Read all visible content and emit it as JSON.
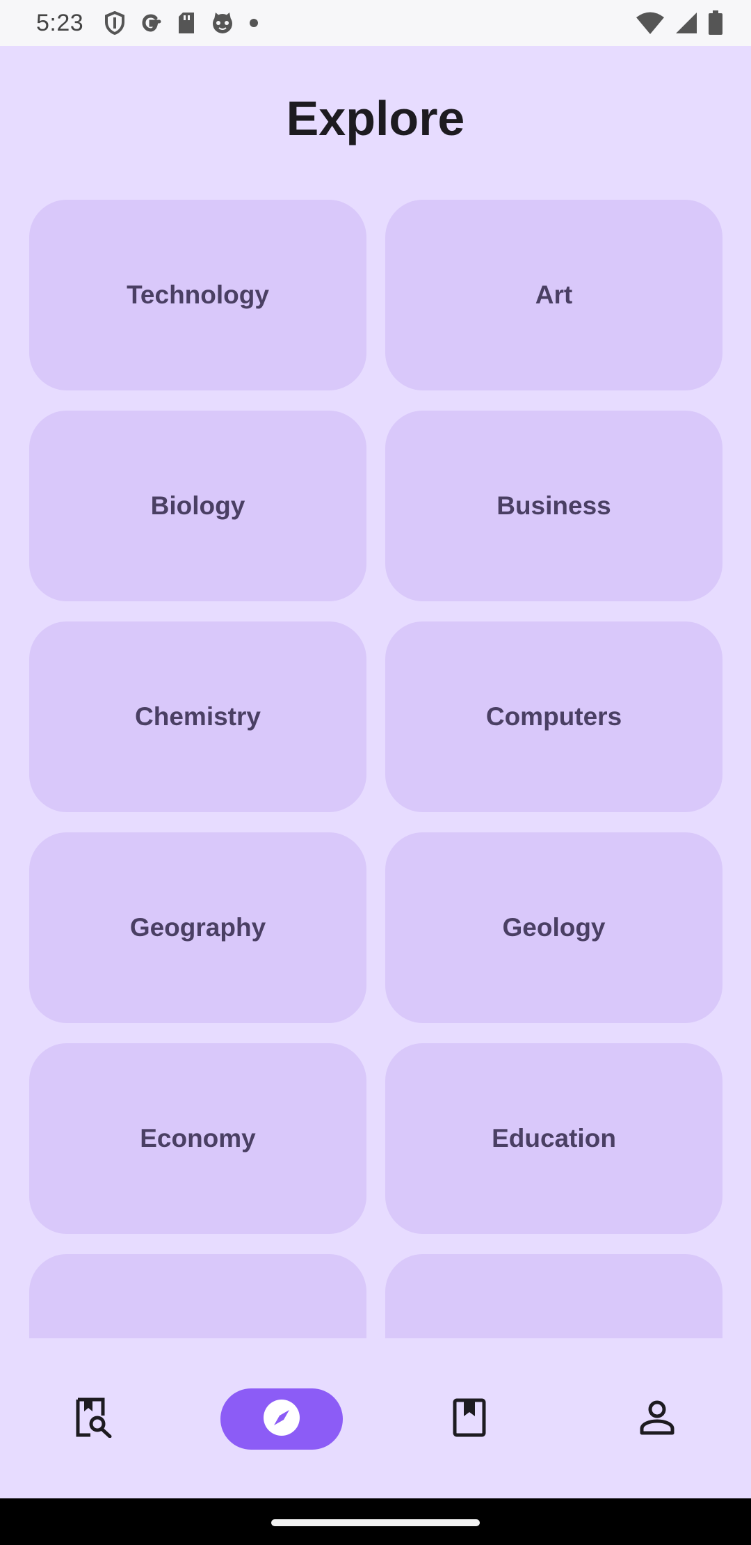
{
  "status_bar": {
    "time": "5:23",
    "left_icons": [
      "shield-icon",
      "google-icon",
      "sd-card-icon",
      "cat-face-icon",
      "notification-dot-icon"
    ],
    "right_icons": [
      "wifi-icon",
      "cellular-signal-icon",
      "battery-icon"
    ]
  },
  "header": {
    "title": "Explore"
  },
  "categories": [
    {
      "label": "Technology"
    },
    {
      "label": "Art"
    },
    {
      "label": "Biology"
    },
    {
      "label": "Business"
    },
    {
      "label": "Chemistry"
    },
    {
      "label": "Computers"
    },
    {
      "label": "Geography"
    },
    {
      "label": "Geology"
    },
    {
      "label": "Economy"
    },
    {
      "label": "Education"
    },
    {
      "label": ""
    },
    {
      "label": ""
    }
  ],
  "bottom_nav": {
    "items": [
      {
        "icon": "library-search-icon",
        "active": false
      },
      {
        "icon": "compass-icon",
        "active": true
      },
      {
        "icon": "bookmark-icon",
        "active": false
      },
      {
        "icon": "person-icon",
        "active": false
      }
    ]
  },
  "colors": {
    "background": "#e7dcff",
    "card": "#d9c8fa",
    "card_text": "#4a3f63",
    "accent": "#8c5cf6",
    "title": "#1d1b20"
  }
}
